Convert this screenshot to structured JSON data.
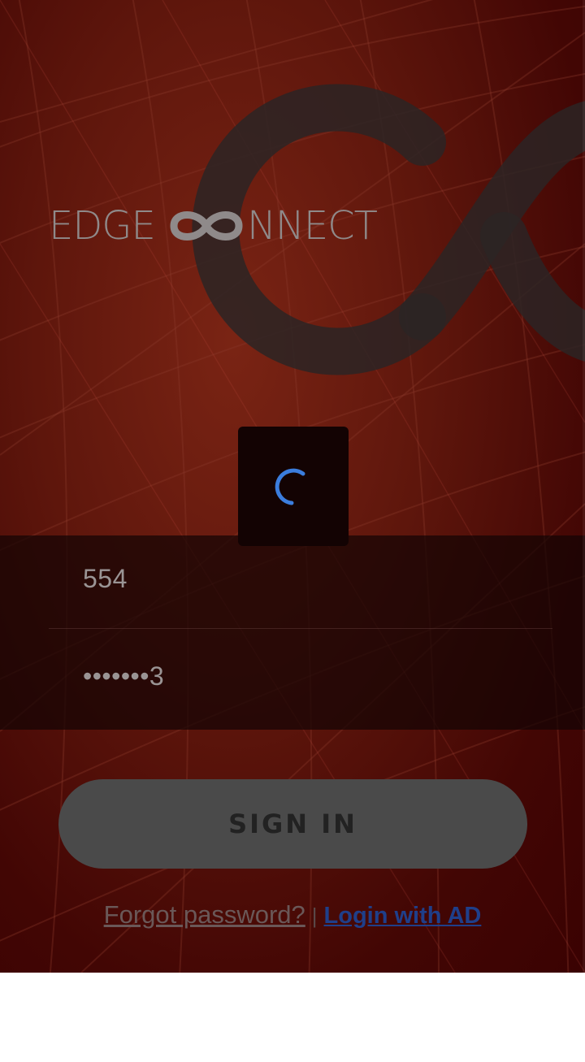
{
  "brand": {
    "left_text": "EDGE",
    "right_text": "NNECT",
    "icon": "infinity-icon",
    "color": "#8f8a8a"
  },
  "login": {
    "username_value": "554",
    "password_value": "•••••••3",
    "signin_label": "SIGN IN",
    "forgot_label": "Forgot password?",
    "separator": "|",
    "ad_label": "Login with AD"
  },
  "loader": {
    "icon": "spinner-icon",
    "color": "#3b7ddd"
  },
  "colors": {
    "background": "#4a0808",
    "button": "#4a4a4a",
    "link_ad": "#1f3f8a"
  }
}
